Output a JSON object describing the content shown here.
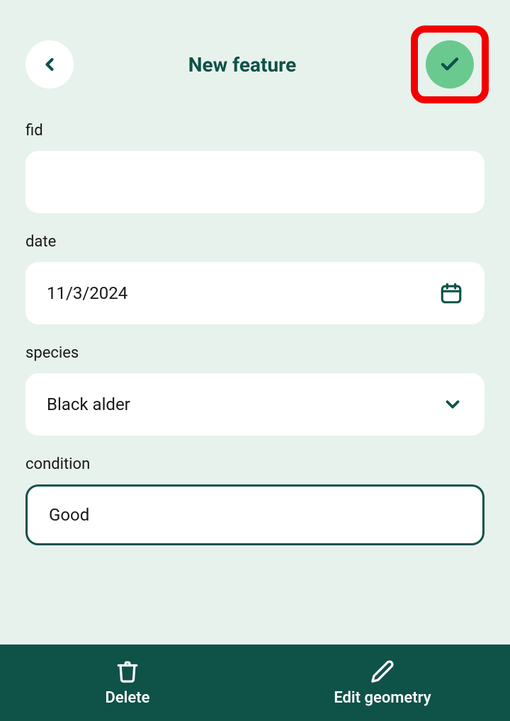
{
  "header": {
    "title": "New feature"
  },
  "fields": {
    "fid": {
      "label": "fid",
      "value": ""
    },
    "date": {
      "label": "date",
      "value": "11/3/2024"
    },
    "species": {
      "label": "species",
      "value": "Black alder"
    },
    "condition": {
      "label": "condition",
      "value": "Good"
    }
  },
  "actions": {
    "delete": "Delete",
    "edit_geometry": "Edit geometry"
  }
}
